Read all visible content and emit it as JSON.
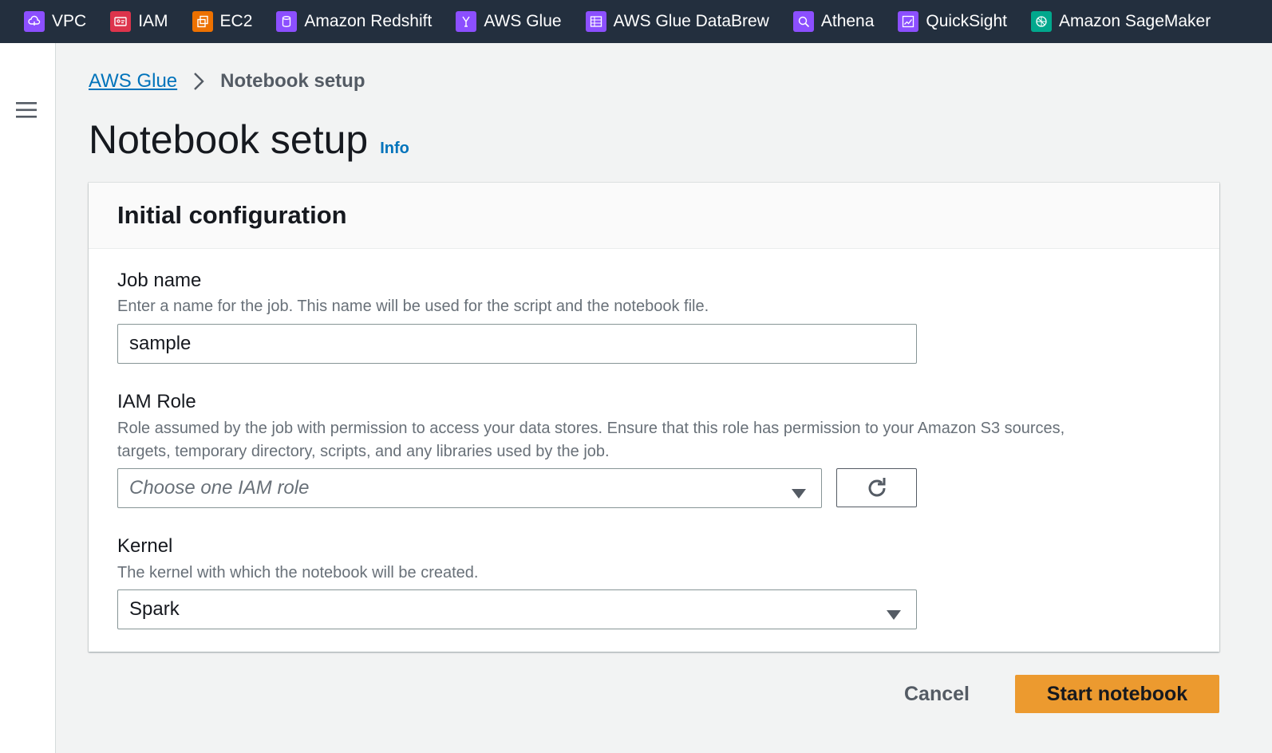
{
  "topbar": {
    "services": [
      {
        "label": "VPC",
        "icon": "vpc-icon",
        "color": "#8c4fff"
      },
      {
        "label": "IAM",
        "icon": "iam-icon",
        "color": "#dd344c"
      },
      {
        "label": "EC2",
        "icon": "ec2-icon",
        "color": "#ed7100"
      },
      {
        "label": "Amazon Redshift",
        "icon": "redshift-icon",
        "color": "#8c4fff"
      },
      {
        "label": "AWS Glue",
        "icon": "glue-icon",
        "color": "#8c4fff"
      },
      {
        "label": "AWS Glue DataBrew",
        "icon": "databrew-icon",
        "color": "#8c4fff"
      },
      {
        "label": "Athena",
        "icon": "athena-icon",
        "color": "#8c4fff"
      },
      {
        "label": "QuickSight",
        "icon": "quicksight-icon",
        "color": "#8c4fff"
      },
      {
        "label": "Amazon SageMaker",
        "icon": "sagemaker-icon",
        "color": "#01a88d"
      }
    ]
  },
  "breadcrumb": {
    "root": "AWS Glue",
    "current": "Notebook setup"
  },
  "page": {
    "title": "Notebook setup",
    "info_link": "Info"
  },
  "panel": {
    "title": "Initial configuration",
    "job_name": {
      "label": "Job name",
      "description": "Enter a name for the job. This name will be used for the script and the notebook file.",
      "value": "sample"
    },
    "iam_role": {
      "label": "IAM Role",
      "description_line1": "Role assumed by the job with permission to access your data stores. Ensure that this role has permission to your Amazon S3 sources,",
      "description_line2": "targets, temporary directory, scripts, and any libraries used by the job.",
      "placeholder": "Choose one IAM role"
    },
    "kernel": {
      "label": "Kernel",
      "description": "The kernel with which the notebook will be created.",
      "value": "Spark"
    }
  },
  "actions": {
    "cancel": "Cancel",
    "start": "Start notebook"
  },
  "colors": {
    "topbar_bg": "#232f3e",
    "link": "#0073bb",
    "primary_button": "#ec9a2f"
  }
}
